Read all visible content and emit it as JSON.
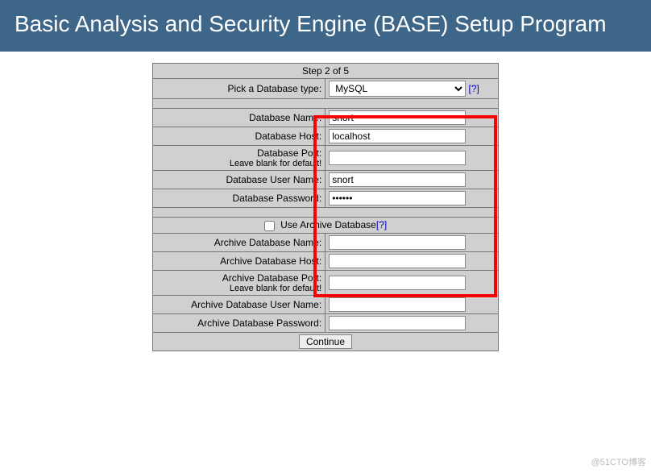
{
  "header": {
    "title": "Basic Analysis and Security Engine (BASE) Setup Program"
  },
  "step": {
    "label": "Step 2 of 5"
  },
  "db": {
    "type_label": "Pick a Database type:",
    "type_value": "MySQL",
    "type_help": "[?]",
    "name_label": "Database Name:",
    "name_value": "snort",
    "host_label": "Database Host:",
    "host_value": "localhost",
    "port_label": "Database Port:",
    "port_sub": "Leave blank for default!",
    "port_value": "",
    "user_label": "Database User Name:",
    "user_value": "snort",
    "password_label": "Database Password:",
    "password_value": "••••••"
  },
  "archive": {
    "use_label": "Use Archive Database",
    "use_help": "[?]",
    "name_label": "Archive Database Name:",
    "name_value": "",
    "host_label": "Archive Database Host:",
    "host_value": "",
    "port_label": "Archive Database Port:",
    "port_sub": "Leave blank for default!",
    "port_value": "",
    "user_label": "Archive Database User Name:",
    "user_value": "",
    "password_label": "Archive Database Password:",
    "password_value": ""
  },
  "actions": {
    "continue": "Continue"
  },
  "watermark": "@51CTO博客"
}
